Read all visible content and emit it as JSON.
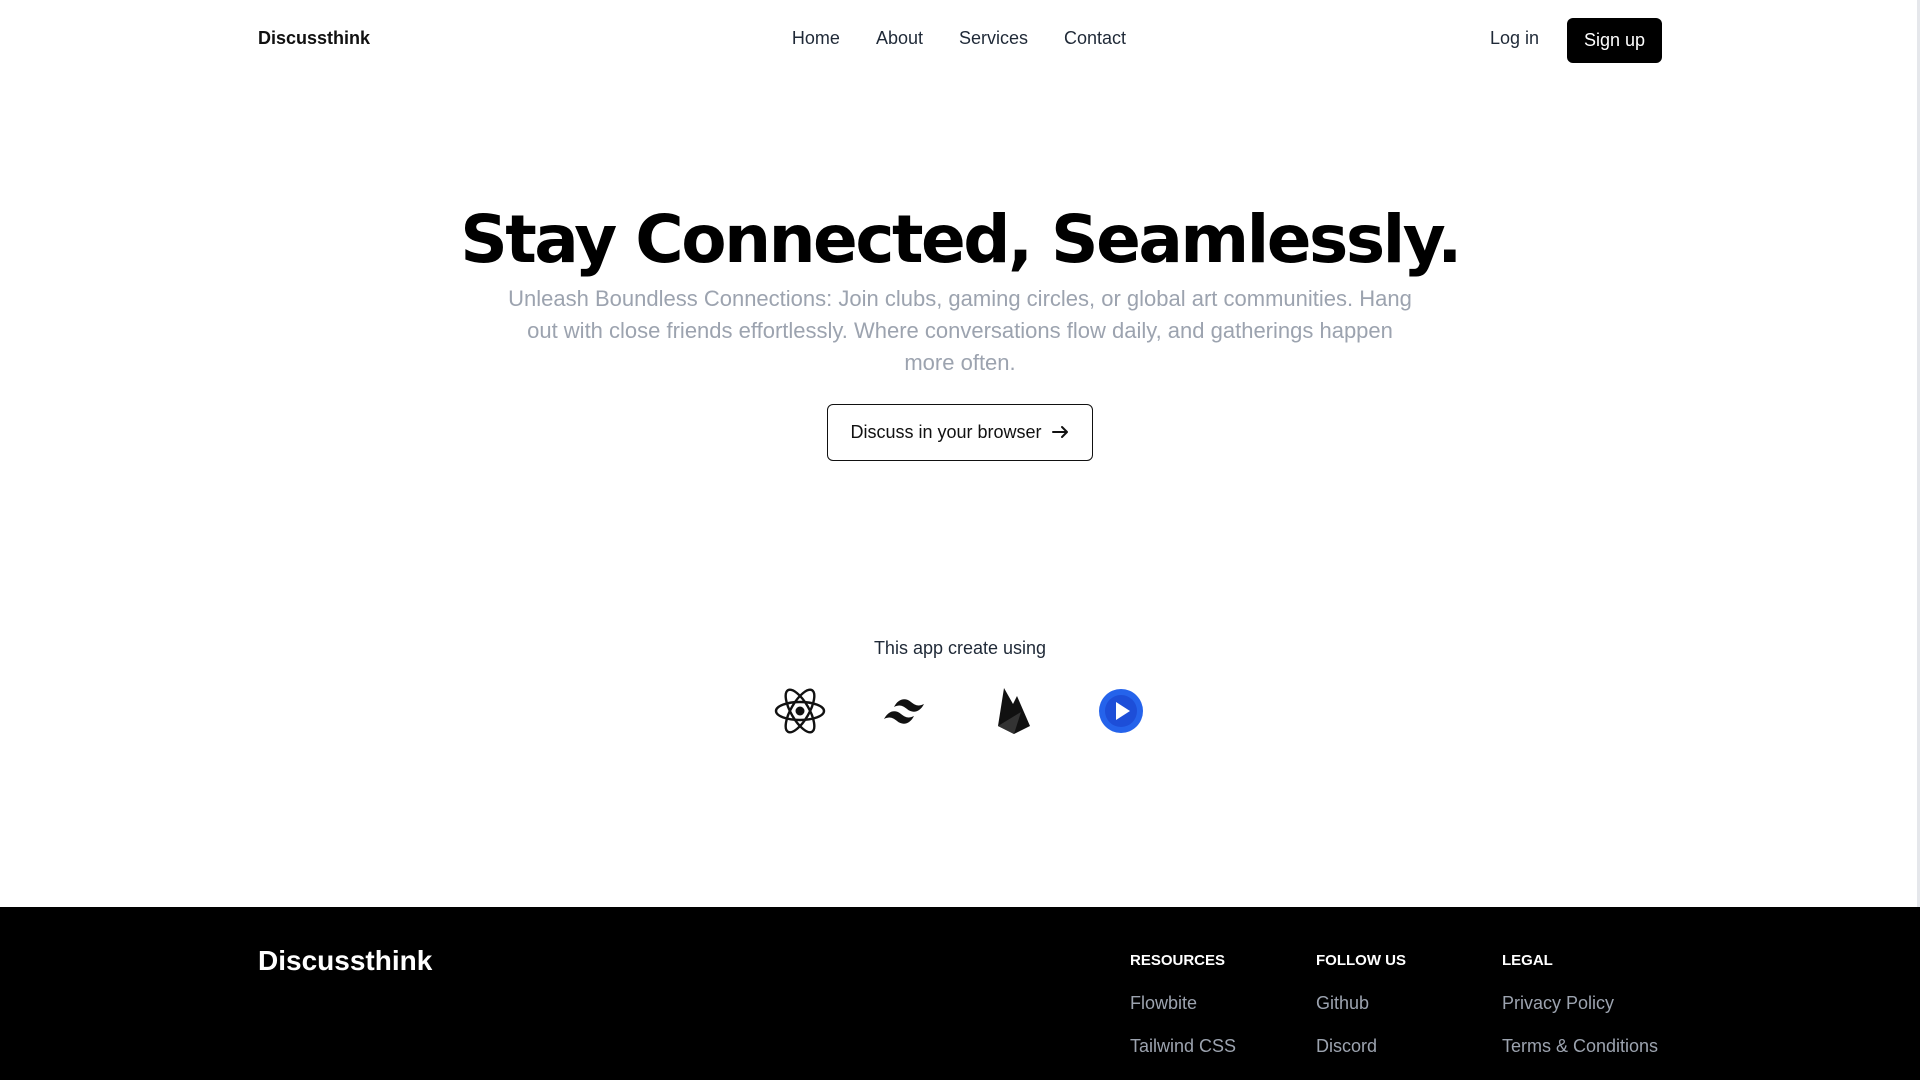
{
  "header": {
    "brand": "Discussthink",
    "nav": [
      {
        "label": "Home"
      },
      {
        "label": "About"
      },
      {
        "label": "Services"
      },
      {
        "label": "Contact"
      }
    ],
    "login_label": "Log in",
    "signup_label": "Sign up"
  },
  "hero": {
    "title": "Stay Connected, Seamlessly.",
    "subtitle": "Unleash Boundless Connections: Join clubs, gaming circles, or global art communities. Hang out with close friends effortlessly. Where conversations flow daily, and gatherings happen more often.",
    "cta_label": "Discuss in your browser",
    "cta_icon": "arrow-right-icon"
  },
  "tech": {
    "caption": "This app create using",
    "icons": [
      "react-icon",
      "tailwind-icon",
      "firebase-icon",
      "play-icon"
    ],
    "colors": {
      "play_icon": "#1d4ed8",
      "play_icon_light": "#3b82f6"
    }
  },
  "footer": {
    "brand": "Discussthink",
    "columns": [
      {
        "heading": "RESOURCES",
        "links": [
          "Flowbite",
          "Tailwind CSS"
        ]
      },
      {
        "heading": "FOLLOW US",
        "links": [
          "Github",
          "Discord"
        ]
      },
      {
        "heading": "LEGAL",
        "links": [
          "Privacy Policy",
          "Terms & Conditions"
        ]
      }
    ]
  },
  "colors": {
    "primary": "#000000",
    "muted_text": "#9ca3af",
    "background": "#ffffff"
  }
}
